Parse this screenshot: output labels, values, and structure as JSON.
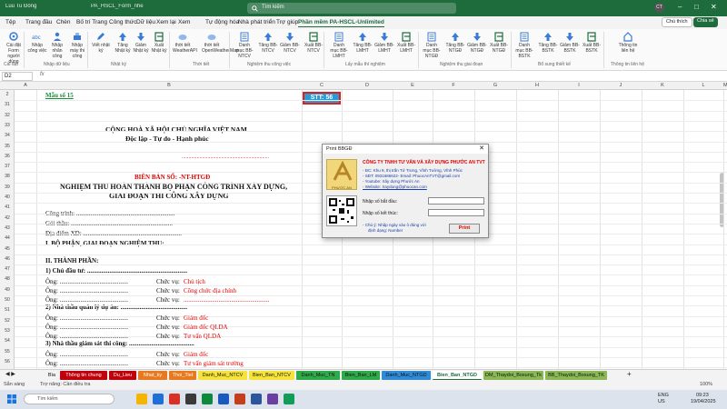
{
  "titlebar": {
    "quick_access": "Luu Tu Đông",
    "doc_name": "PA_HSCL_Form_nhe",
    "search_placeholder": "Tìm kiếm",
    "user_initials": "CT"
  },
  "menu": {
    "tabs": [
      "Tệp",
      "Trang đầu",
      "Chèn",
      "Bố trí Trang",
      "Công thức",
      "Dữ liệu",
      "Xem lại",
      "Xem",
      "Tự động hóa",
      "Nhà phát triển",
      "Trợ giúp",
      "Phần mềm PA-HSCL-Unlimited"
    ],
    "comments": "Chú thích",
    "share": "Chia sẻ"
  },
  "ribbon": {
    "buttons": [
      {
        "label": "Cài đặt Form người dùng",
        "icon": "gear-icon",
        "color": "#3a7bd5"
      },
      {
        "label": "Nhập công việc",
        "icon": "abc-icon",
        "color": "#3a7bd5"
      },
      {
        "label": "Nhập nhân công",
        "icon": "user-icon",
        "color": "#3a7bd5"
      },
      {
        "label": "Nhập máy thi công",
        "icon": "tools-icon",
        "color": "#3a7bd5"
      },
      {
        "label": "Viết nhật ký",
        "icon": "pencil-icon",
        "color": "#3a7bd5"
      },
      {
        "label": "Tăng Nhật ký",
        "icon": "arrow-up-icon",
        "color": "#3a7bd5"
      },
      {
        "label": "Giảm Nhật ký",
        "icon": "arrow-down-icon",
        "color": "#3a7bd5"
      },
      {
        "label": "Xuất Nhật ký",
        "icon": "export-icon",
        "color": "#3a7bd5"
      },
      {
        "label": "thời tiết WeatherAPI",
        "icon": "cloud-icon",
        "color": "#3a7bd5"
      },
      {
        "label": "thời tiết OpenWeatherMap",
        "icon": "cloud-icon",
        "color": "#3a7bd5"
      },
      {
        "label": "Danh mục BB-NTCV",
        "icon": "list-icon",
        "color": "#3a7bd5"
      },
      {
        "label": "Tăng BB-NTCV",
        "icon": "arrow-up-icon",
        "color": "#3a7bd5"
      },
      {
        "label": "Giảm BB-NTCV",
        "icon": "arrow-down-icon",
        "color": "#3a7bd5"
      },
      {
        "label": "Xuất BB-NTCV",
        "icon": "export-icon",
        "color": "#3a7bd5"
      },
      {
        "label": "Danh mục BB-LMHT",
        "icon": "list-icon",
        "color": "#3a7bd5"
      },
      {
        "label": "Tăng BB-LMHT",
        "icon": "arrow-up-icon",
        "color": "#3a7bd5"
      },
      {
        "label": "Giảm BB-LMHT",
        "icon": "arrow-down-icon",
        "color": "#3a7bd5"
      },
      {
        "label": "Xuất BB-LMHT",
        "icon": "export-icon",
        "color": "#3a7bd5"
      },
      {
        "label": "Danh mục BB-NTGĐ",
        "icon": "list-icon",
        "color": "#3a7bd5"
      },
      {
        "label": "Tăng BB-NTGĐ",
        "icon": "arrow-up-icon",
        "color": "#3a7bd5"
      },
      {
        "label": "Giảm BB-NTGĐ",
        "icon": "arrow-down-icon",
        "color": "#3a7bd5"
      },
      {
        "label": "Xuất BB-NTGĐ",
        "icon": "export-icon",
        "color": "#3a7bd5"
      },
      {
        "label": "Danh mục BB-BSTK",
        "icon": "list-icon",
        "color": "#3a7bd5"
      },
      {
        "label": "Tăng BB-BSTK",
        "icon": "arrow-up-icon",
        "color": "#3a7bd5"
      },
      {
        "label": "Giảm BB-BSTK",
        "icon": "arrow-down-icon",
        "color": "#3a7bd5"
      },
      {
        "label": "Xuất BB-BSTK",
        "icon": "export-icon",
        "color": "#3a7bd5"
      },
      {
        "label": "Thông tin liên hệ",
        "icon": "home-icon",
        "color": "#3a7bd5"
      }
    ],
    "groups": [
      "Cài đặt",
      "Nhập dữ liệu",
      "Nhật ký",
      "Thời tiết",
      "Nghiệm thu công việc",
      "Lấy mẫu thí nghiệm",
      "Nghiệm thu giai đoạn",
      "Bổ sung thiết kế",
      "Thông tin liên hệ"
    ]
  },
  "formula_bar": {
    "name_box": "D2",
    "fx": "fx"
  },
  "grid": {
    "columns": [
      "A",
      "B",
      "C",
      "D",
      "E",
      "F",
      "G",
      "H",
      "I",
      "J",
      "K",
      "L",
      "M",
      "N"
    ],
    "rows": [
      "2",
      "31",
      "32",
      "33",
      "34",
      "35",
      "36",
      "37",
      "38",
      "39",
      "40",
      "41",
      "42",
      "43",
      "44",
      "45",
      "46",
      "47",
      "48",
      "49",
      "50",
      "51",
      "52",
      "53",
      "54",
      "55",
      "56"
    ],
    "stt_badge": "STT: 56"
  },
  "document": {
    "form_no": "Mẫu số 15",
    "nation": "CỘNG HOÀ XÃ HỘI CHỦ NGHĨA VIỆT NAM",
    "motto": "Độc lập - Tự do - Hạnh phúc",
    "dots_right": "................................................................",
    "record_no": "BIÊN BẢN SỐ: -NT-HTGĐ",
    "heading1": "NGHIỆM THU HOÀN THÀNH BỘ PHẬN CÔNG TRÌNH XÂY DỰNG,",
    "heading2": "GIAI ĐOẠN THI CÔNG XÂY DỰNG",
    "cong_trinh": "Công trình: ..............................................................",
    "goi_thau": "Gói thầu: ................................................................",
    "dia_diem": "Địa điểm XD: ..............................................................",
    "section1": "I. BỘ PHẬN, GIAI ĐOẠN NGHIỆM THU:",
    "section2": "II. THÀNH PHẦN:",
    "sub1": "1) Chủ đầu tư: ...............................................................",
    "sub2": "2) Nhà thầu quản lý dự án: ..........................................",
    "sub3": "3) Nhà thầu giám sát thi công: .........................................",
    "ong_prefix": "Ông: ...........................................",
    "chuc_vu": "Chức vụ:",
    "roles": [
      "Chủ tịch",
      "Công chức địa chính",
      "......................................................",
      "Giám đốc",
      "Giám đốc QLDA",
      "Tư vấn QLDA",
      "Giám đốc",
      "Tư vấn giám sát trường"
    ]
  },
  "dialog": {
    "title": "Print BBGĐ",
    "logo_text": "PHƯỚC AN",
    "company": "CÔNG TY TNHH TƯ VẤN VÀ XÂY DỰNG PHƯỚC AN TVT",
    "address": "- ĐC: Khu 9, thị trấn Tứ Trưng, Vĩnh Tường, Vĩnh Phúc",
    "phone": "- SĐT: 0931686622- Email: PhuocAnTVT@gmail.com",
    "youtube": "- Youtube:  Xây dựng Phước An",
    "website": "- Website:  Xaydung@phuocan.com",
    "start_label": "Nhập số bắt đầu:",
    "end_label": "Nhập số kết thúc:",
    "note1": "- Chú ý: Nhập ngày vào ô đúng với",
    "note2": "định dạng: Number",
    "print_label": "Print"
  },
  "sheet_tabs": [
    {
      "label": "Bìa",
      "bg": "#f3f3f3",
      "fg": "#111"
    },
    {
      "label": "Thông tin chung",
      "bg": "#c0000b",
      "fg": "#fff"
    },
    {
      "label": "Du_Lieu",
      "bg": "#c0000b",
      "fg": "#fff"
    },
    {
      "label": "Nhat_ky",
      "bg": "#e8791e",
      "fg": "#fff"
    },
    {
      "label": "Thoi_Tiet",
      "bg": "#e8791e",
      "fg": "#fff"
    },
    {
      "label": "Danh_Muc_NTCV",
      "bg": "#f5e33a",
      "fg": "#111"
    },
    {
      "label": "Bien_Ban_NTCV",
      "bg": "#f5e33a",
      "fg": "#111"
    },
    {
      "label": "Danh_Muc_TN",
      "bg": "#2faa4a",
      "fg": "#111"
    },
    {
      "label": "Bien_Ban_LM",
      "bg": "#2faa4a",
      "fg": "#111"
    },
    {
      "label": "Danh_Muc_NTGD",
      "bg": "#2f8bd6",
      "fg": "#111"
    },
    {
      "label": "Bien_Ban_NTGD",
      "bg": "#ffffff",
      "fg": "#1e6b3c"
    },
    {
      "label": "DM_Thaydoi_Bosung_Tk",
      "bg": "#8ab854",
      "fg": "#111"
    },
    {
      "label": "BB_Thaydoi_Bosung_TK",
      "bg": "#8ab854",
      "fg": "#111"
    }
  ],
  "status": {
    "ready": "Sẵn sàng",
    "accessibility": "Trợ năng: Cần điều tra",
    "zoom": "100%"
  },
  "taskbar": {
    "search_placeholder": "Tìm kiếm",
    "lang": "ENG",
    "region": "US",
    "time": "09:23",
    "date": "19/04/2025"
  }
}
